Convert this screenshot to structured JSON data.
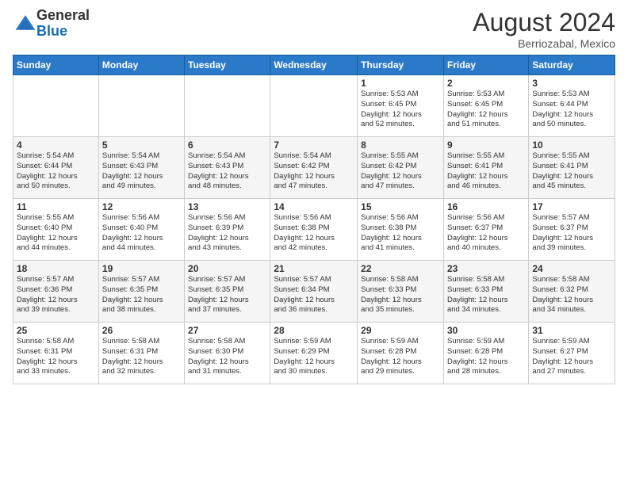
{
  "header": {
    "logo_general": "General",
    "logo_blue": "Blue",
    "month_title": "August 2024",
    "location": "Berriozabal, Mexico"
  },
  "weekdays": [
    "Sunday",
    "Monday",
    "Tuesday",
    "Wednesday",
    "Thursday",
    "Friday",
    "Saturday"
  ],
  "weeks": [
    [
      {
        "day": "",
        "info": ""
      },
      {
        "day": "",
        "info": ""
      },
      {
        "day": "",
        "info": ""
      },
      {
        "day": "",
        "info": ""
      },
      {
        "day": "1",
        "info": "Sunrise: 5:53 AM\nSunset: 6:45 PM\nDaylight: 12 hours\nand 52 minutes."
      },
      {
        "day": "2",
        "info": "Sunrise: 5:53 AM\nSunset: 6:45 PM\nDaylight: 12 hours\nand 51 minutes."
      },
      {
        "day": "3",
        "info": "Sunrise: 5:53 AM\nSunset: 6:44 PM\nDaylight: 12 hours\nand 50 minutes."
      }
    ],
    [
      {
        "day": "4",
        "info": "Sunrise: 5:54 AM\nSunset: 6:44 PM\nDaylight: 12 hours\nand 50 minutes."
      },
      {
        "day": "5",
        "info": "Sunrise: 5:54 AM\nSunset: 6:43 PM\nDaylight: 12 hours\nand 49 minutes."
      },
      {
        "day": "6",
        "info": "Sunrise: 5:54 AM\nSunset: 6:43 PM\nDaylight: 12 hours\nand 48 minutes."
      },
      {
        "day": "7",
        "info": "Sunrise: 5:54 AM\nSunset: 6:42 PM\nDaylight: 12 hours\nand 47 minutes."
      },
      {
        "day": "8",
        "info": "Sunrise: 5:55 AM\nSunset: 6:42 PM\nDaylight: 12 hours\nand 47 minutes."
      },
      {
        "day": "9",
        "info": "Sunrise: 5:55 AM\nSunset: 6:41 PM\nDaylight: 12 hours\nand 46 minutes."
      },
      {
        "day": "10",
        "info": "Sunrise: 5:55 AM\nSunset: 6:41 PM\nDaylight: 12 hours\nand 45 minutes."
      }
    ],
    [
      {
        "day": "11",
        "info": "Sunrise: 5:55 AM\nSunset: 6:40 PM\nDaylight: 12 hours\nand 44 minutes."
      },
      {
        "day": "12",
        "info": "Sunrise: 5:56 AM\nSunset: 6:40 PM\nDaylight: 12 hours\nand 44 minutes."
      },
      {
        "day": "13",
        "info": "Sunrise: 5:56 AM\nSunset: 6:39 PM\nDaylight: 12 hours\nand 43 minutes."
      },
      {
        "day": "14",
        "info": "Sunrise: 5:56 AM\nSunset: 6:38 PM\nDaylight: 12 hours\nand 42 minutes."
      },
      {
        "day": "15",
        "info": "Sunrise: 5:56 AM\nSunset: 6:38 PM\nDaylight: 12 hours\nand 41 minutes."
      },
      {
        "day": "16",
        "info": "Sunrise: 5:56 AM\nSunset: 6:37 PM\nDaylight: 12 hours\nand 40 minutes."
      },
      {
        "day": "17",
        "info": "Sunrise: 5:57 AM\nSunset: 6:37 PM\nDaylight: 12 hours\nand 39 minutes."
      }
    ],
    [
      {
        "day": "18",
        "info": "Sunrise: 5:57 AM\nSunset: 6:36 PM\nDaylight: 12 hours\nand 39 minutes."
      },
      {
        "day": "19",
        "info": "Sunrise: 5:57 AM\nSunset: 6:35 PM\nDaylight: 12 hours\nand 38 minutes."
      },
      {
        "day": "20",
        "info": "Sunrise: 5:57 AM\nSunset: 6:35 PM\nDaylight: 12 hours\nand 37 minutes."
      },
      {
        "day": "21",
        "info": "Sunrise: 5:57 AM\nSunset: 6:34 PM\nDaylight: 12 hours\nand 36 minutes."
      },
      {
        "day": "22",
        "info": "Sunrise: 5:58 AM\nSunset: 6:33 PM\nDaylight: 12 hours\nand 35 minutes."
      },
      {
        "day": "23",
        "info": "Sunrise: 5:58 AM\nSunset: 6:33 PM\nDaylight: 12 hours\nand 34 minutes."
      },
      {
        "day": "24",
        "info": "Sunrise: 5:58 AM\nSunset: 6:32 PM\nDaylight: 12 hours\nand 34 minutes."
      }
    ],
    [
      {
        "day": "25",
        "info": "Sunrise: 5:58 AM\nSunset: 6:31 PM\nDaylight: 12 hours\nand 33 minutes."
      },
      {
        "day": "26",
        "info": "Sunrise: 5:58 AM\nSunset: 6:31 PM\nDaylight: 12 hours\nand 32 minutes."
      },
      {
        "day": "27",
        "info": "Sunrise: 5:58 AM\nSunset: 6:30 PM\nDaylight: 12 hours\nand 31 minutes."
      },
      {
        "day": "28",
        "info": "Sunrise: 5:59 AM\nSunset: 6:29 PM\nDaylight: 12 hours\nand 30 minutes."
      },
      {
        "day": "29",
        "info": "Sunrise: 5:59 AM\nSunset: 6:28 PM\nDaylight: 12 hours\nand 29 minutes."
      },
      {
        "day": "30",
        "info": "Sunrise: 5:59 AM\nSunset: 6:28 PM\nDaylight: 12 hours\nand 28 minutes."
      },
      {
        "day": "31",
        "info": "Sunrise: 5:59 AM\nSunset: 6:27 PM\nDaylight: 12 hours\nand 27 minutes."
      }
    ]
  ]
}
